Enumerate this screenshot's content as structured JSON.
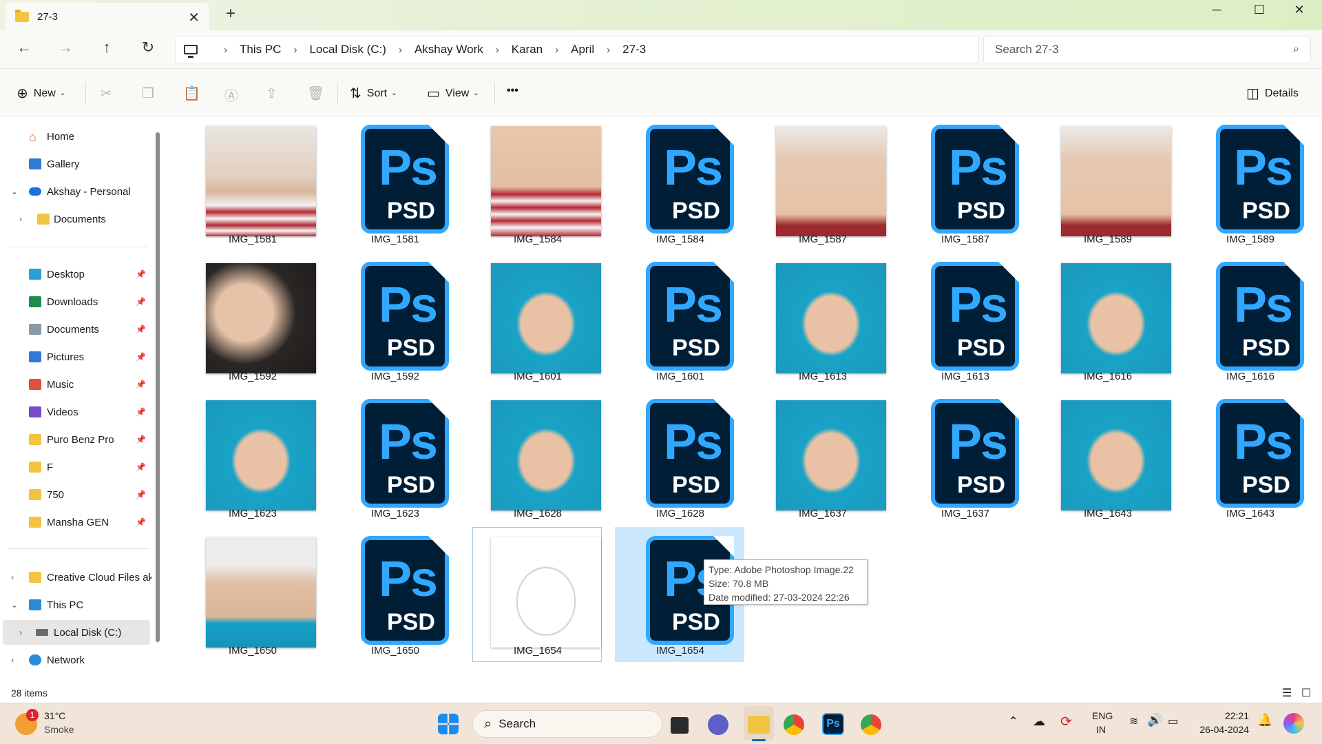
{
  "window": {
    "tab_title": "27-3",
    "new_tab": "+",
    "minimize": "─",
    "maximize": "☐",
    "close": "✕"
  },
  "address": {
    "crumbs": [
      "This PC",
      "Local Disk (C:)",
      "Akshay Work",
      "Karan",
      "April",
      "27-3"
    ],
    "search_placeholder": "Search 27-3"
  },
  "toolbar": {
    "new": "New",
    "sort": "Sort",
    "view": "View",
    "more": "•••",
    "details": "Details"
  },
  "sidebar": {
    "home": "Home",
    "gallery": "Gallery",
    "personal": "Akshay - Personal",
    "documents_cloud": "Documents",
    "quick": [
      {
        "label": "Desktop",
        "icon": "desktop-icon"
      },
      {
        "label": "Downloads",
        "icon": "downloads-icon"
      },
      {
        "label": "Documents",
        "icon": "documents-icon"
      },
      {
        "label": "Pictures",
        "icon": "pictures-icon"
      },
      {
        "label": "Music",
        "icon": "music-icon"
      },
      {
        "label": "Videos",
        "icon": "videos-icon"
      },
      {
        "label": "Puro Benz Pro",
        "icon": "folder-icon"
      },
      {
        "label": "F",
        "icon": "folder-icon"
      },
      {
        "label": "750",
        "icon": "folder-icon"
      },
      {
        "label": "Mansha GEN",
        "icon": "folder-icon"
      }
    ],
    "creative_cloud": "Creative Cloud Files ak",
    "this_pc": "This PC",
    "local_disk": "Local Disk (C:)",
    "network": "Network"
  },
  "files": [
    {
      "name": "IMG_1581",
      "kind": "photo",
      "scene": "ear-hand"
    },
    {
      "name": "IMG_1581",
      "kind": "psd"
    },
    {
      "name": "IMG_1584",
      "kind": "photo",
      "scene": "necklace-stripe"
    },
    {
      "name": "IMG_1584",
      "kind": "psd"
    },
    {
      "name": "IMG_1587",
      "kind": "photo",
      "scene": "necklace-neck"
    },
    {
      "name": "IMG_1587",
      "kind": "psd"
    },
    {
      "name": "IMG_1589",
      "kind": "photo",
      "scene": "necklace-neck"
    },
    {
      "name": "IMG_1589",
      "kind": "psd"
    },
    {
      "name": "IMG_1592",
      "kind": "photo",
      "scene": "earring"
    },
    {
      "name": "IMG_1592",
      "kind": "psd"
    },
    {
      "name": "IMG_1601",
      "kind": "photo",
      "scene": "hand-blue"
    },
    {
      "name": "IMG_1601",
      "kind": "psd"
    },
    {
      "name": "IMG_1613",
      "kind": "photo",
      "scene": "hand-blue"
    },
    {
      "name": "IMG_1613",
      "kind": "psd"
    },
    {
      "name": "IMG_1616",
      "kind": "photo",
      "scene": "hand-blue"
    },
    {
      "name": "IMG_1616",
      "kind": "psd"
    },
    {
      "name": "IMG_1623",
      "kind": "photo",
      "scene": "hand-blue"
    },
    {
      "name": "IMG_1623",
      "kind": "psd"
    },
    {
      "name": "IMG_1628",
      "kind": "photo",
      "scene": "hand-blue"
    },
    {
      "name": "IMG_1628",
      "kind": "psd"
    },
    {
      "name": "IMG_1637",
      "kind": "photo",
      "scene": "hand-blue"
    },
    {
      "name": "IMG_1637",
      "kind": "psd"
    },
    {
      "name": "IMG_1643",
      "kind": "photo",
      "scene": "hand-blue"
    },
    {
      "name": "IMG_1643",
      "kind": "psd"
    },
    {
      "name": "IMG_1650",
      "kind": "photo",
      "scene": "foot-blue"
    },
    {
      "name": "IMG_1650",
      "kind": "psd"
    },
    {
      "name": "IMG_1654",
      "kind": "photo",
      "scene": "anklet-white",
      "state": "hover"
    },
    {
      "name": "IMG_1654",
      "kind": "psd",
      "state": "selected"
    }
  ],
  "tooltip": {
    "type": "Type: Adobe Photoshop Image.22",
    "size": "Size: 70.8 MB",
    "modified": "Date modified: 27-03-2024 22:26"
  },
  "status": {
    "items": "28 items"
  },
  "taskbar": {
    "weather_temp": "31°C",
    "weather_desc": "Smoke",
    "weather_badge": "1",
    "search": "Search",
    "lang": "ENG",
    "region": "IN",
    "time": "22:21",
    "date": "26-04-2024"
  },
  "colors": {
    "ps_blue": "#31a8ff",
    "ps_navy": "#001e36",
    "selection": "#cce8ff",
    "folder": "#f3c440"
  }
}
